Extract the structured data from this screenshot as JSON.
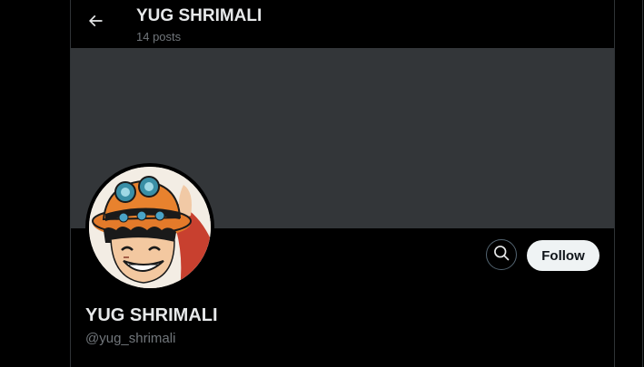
{
  "header": {
    "title": "YUG SHRIMALI",
    "posts_count": "14 posts",
    "back_icon": "arrow-left-icon"
  },
  "profile": {
    "display_name": "YUG SHRIMALI",
    "handle": "@yug_shrimali",
    "avatar_description_icon": "avatar-anime-character"
  },
  "actions": {
    "search_icon": "search-icon",
    "follow_label": "Follow"
  },
  "colors": {
    "background": "#000000",
    "banner": "#333639",
    "primary_text": "#e7e9ea",
    "secondary_text": "#71767b",
    "follow_bg": "#eff3f4",
    "follow_text": "#0f1419",
    "border": "#2f3336"
  }
}
